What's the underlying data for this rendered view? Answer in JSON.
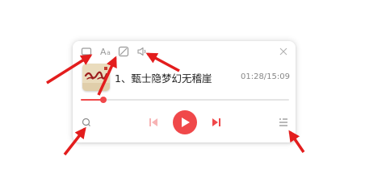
{
  "player": {
    "song_title": "1、甄士隐梦幻无稽崖",
    "elapsed_time": "01:28",
    "total_time": "15:09",
    "time_display": "01:28/15:09",
    "progress_fraction": 0.11,
    "album_art_text": "红楼梦"
  },
  "colors": {
    "accent": "#f0484a",
    "icon_gray": "#9a9a9a",
    "text": "#222222",
    "time_text": "#888888"
  },
  "icons": {
    "top_bar": [
      "mini-mode-icon",
      "font-size-icon",
      "no-image-icon",
      "volume-icon",
      "close-icon"
    ],
    "controls": [
      "search-icon",
      "previous-icon",
      "play-icon",
      "next-icon",
      "playlist-icon"
    ]
  }
}
